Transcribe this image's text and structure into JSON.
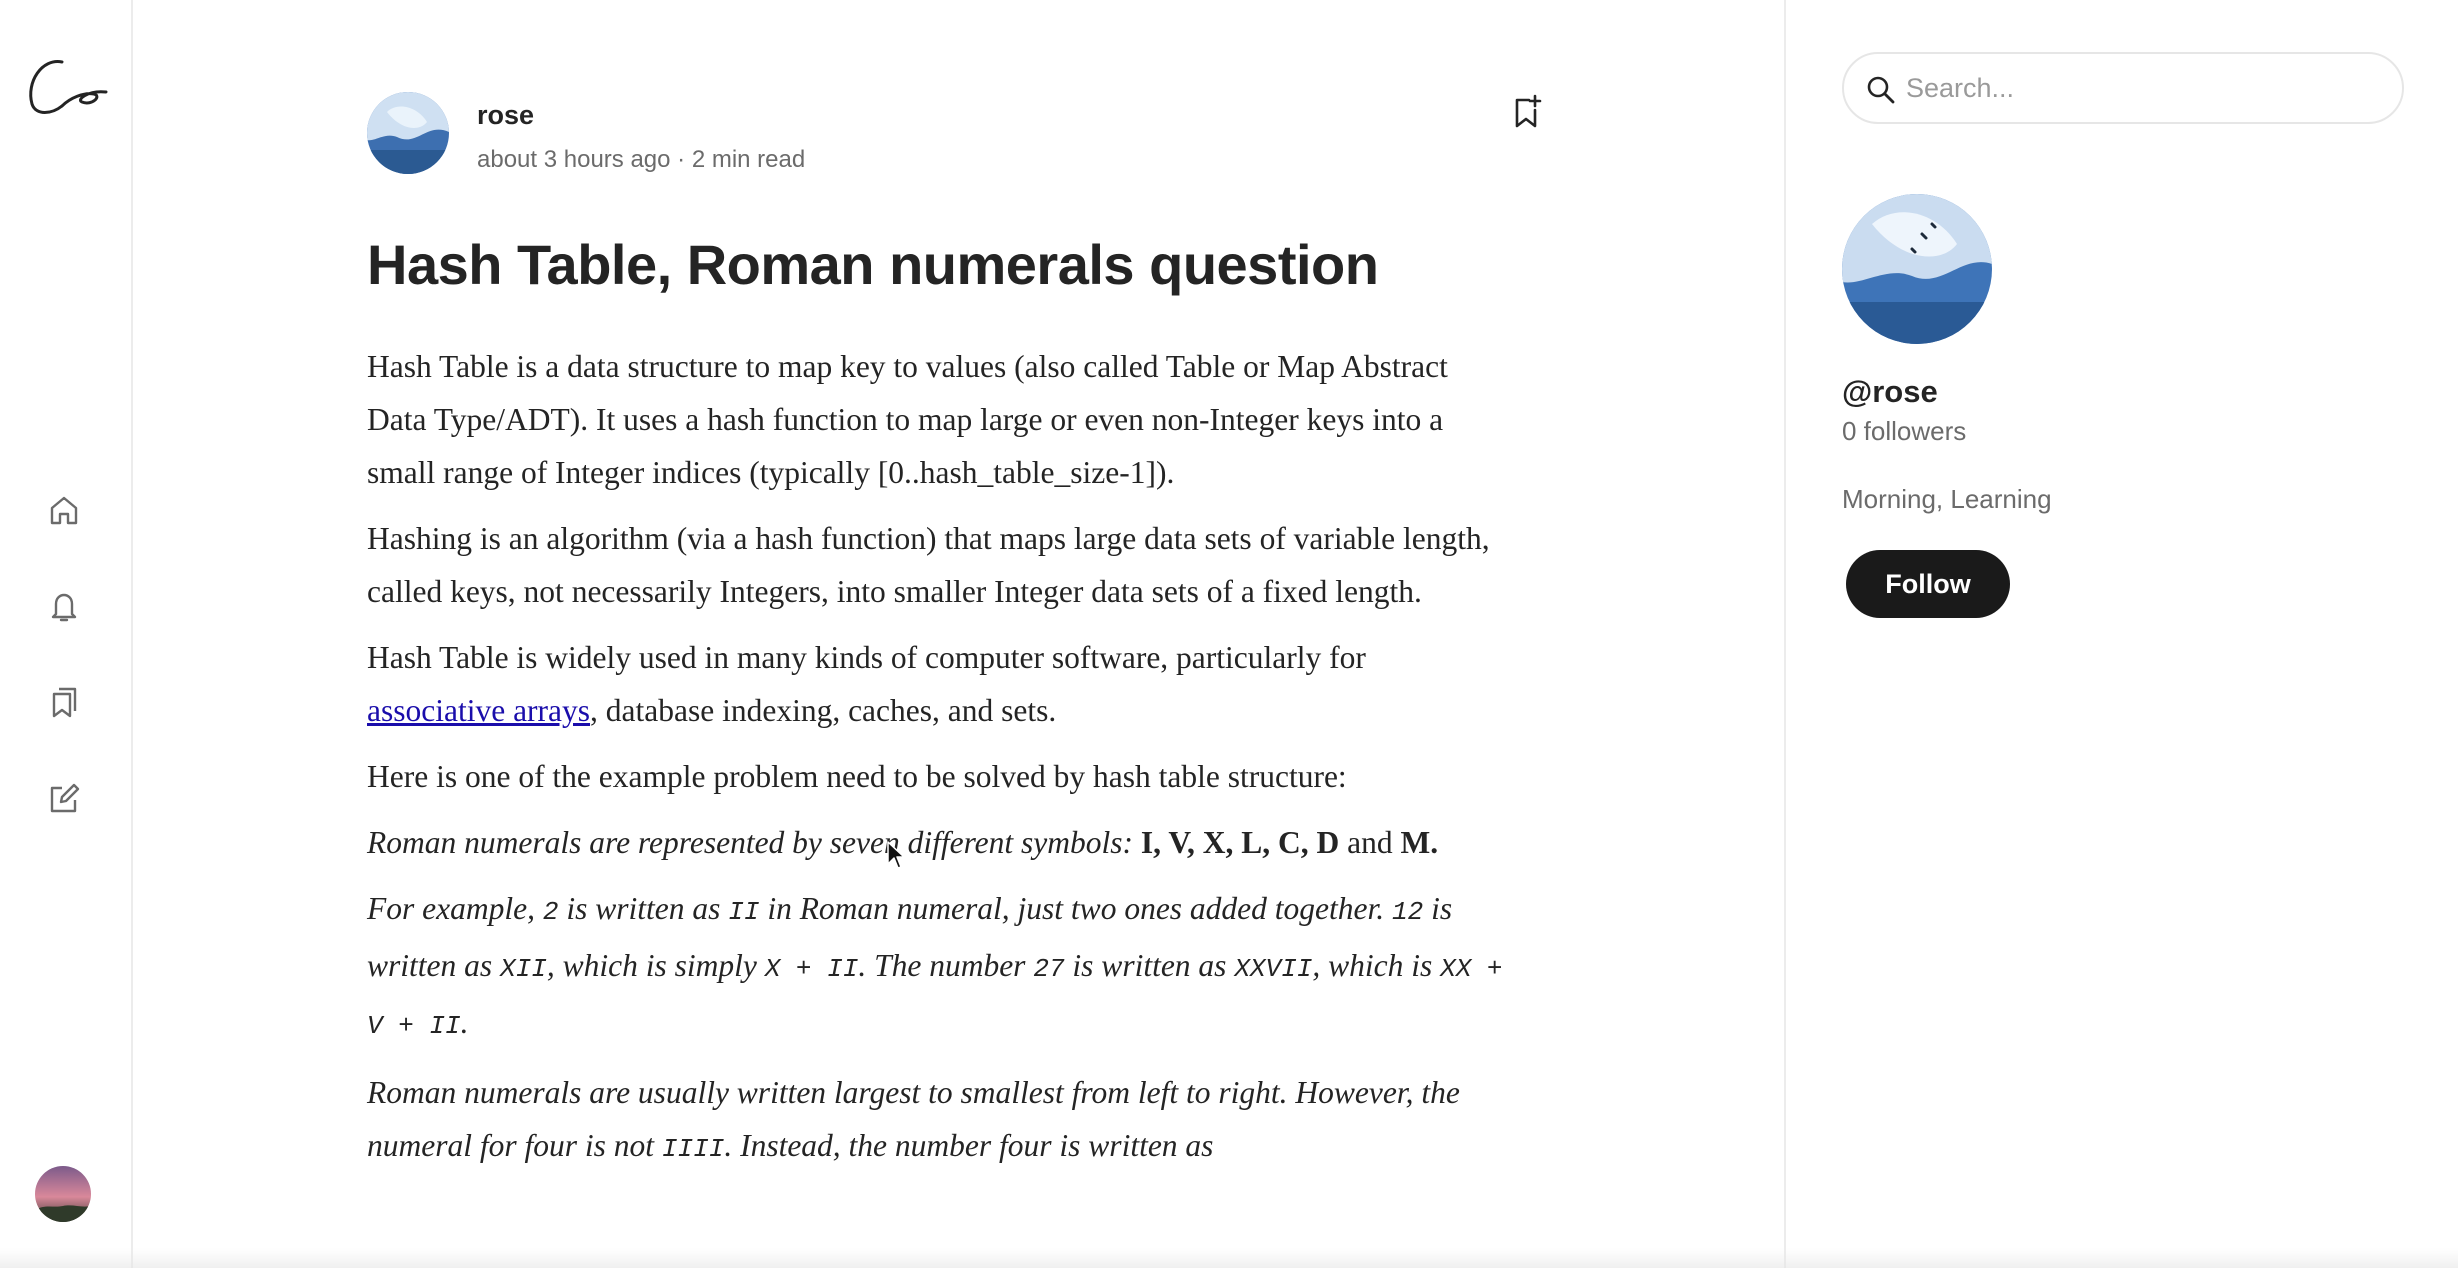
{
  "rail": {
    "logo_text": "Co",
    "icons": [
      "home-icon",
      "bell-icon",
      "bookmarks-icon",
      "write-icon"
    ]
  },
  "article": {
    "author": "rose",
    "meta": "about 3 hours ago · 2 min read",
    "title": "Hash Table, Roman numerals question",
    "p1": "Hash Table is a data structure to map key to values (also called Table or Map Abstract Data Type/ADT). It uses a hash function to map large or even non-Integer keys into a small range of Integer indices (typically [0..hash_table_size-1]).",
    "p2": "Hashing is an algorithm (via a hash function) that maps large data sets of variable length, called keys, not necessarily Integers, into smaller Integer data sets of a fixed length.",
    "p3_start": "Hash Table is widely used in many kinds of computer software, particularly for ",
    "p3_link": "associative arrays",
    "p3_end": ", database indexing, caches, and sets.",
    "p4": "Here is one of the example problem need to be solved by hash table structure:",
    "p5_italic": "Roman numerals are represented by seven different symbols: ",
    "p5_symbols": "I, V, X, L, C, D",
    "p5_and": " and ",
    "p5_m": "M.",
    "p6": {
      "t1": "For example, ",
      "c1": "2",
      "t2": " is written as ",
      "c2": "II",
      "t3": " in Roman numeral, just two ones added together. ",
      "c3": "12",
      "t4": " is written as ",
      "c4": "XII",
      "t5": ", which is simply ",
      "c5": "X + II",
      "t6": ". The number ",
      "c6": "27",
      "t7": " is written as ",
      "c7": "XXVII",
      "t8": ", which is ",
      "c8": "XX + V + II",
      "t9": "."
    },
    "p7": {
      "t1": "Roman numerals are usually written largest to smallest from left to right. However, the numeral for four is not ",
      "c1": "IIII",
      "t2": ". Instead, the number four is written as"
    }
  },
  "sidebar": {
    "search_placeholder": "Search...",
    "handle": "@rose",
    "followers": "0 followers",
    "bio": "Morning, Learning",
    "follow_label": "Follow"
  },
  "colors": {
    "text": "#242424",
    "muted": "#6b6b6b",
    "link": "#1a0dab",
    "follow_bg": "#1a1a1a"
  }
}
